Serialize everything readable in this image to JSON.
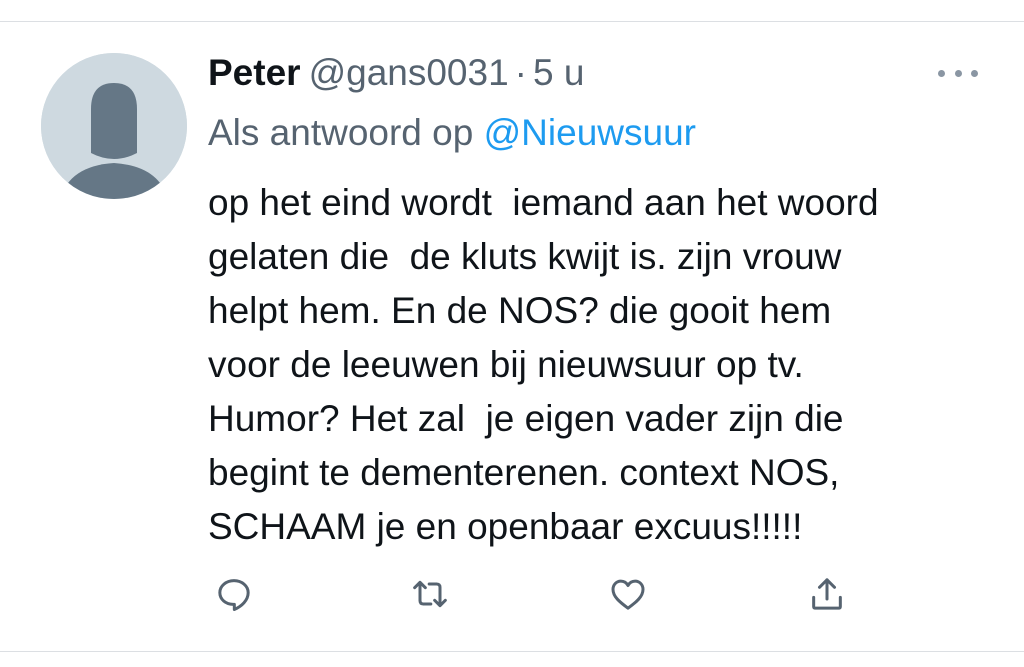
{
  "tweet": {
    "author_name": "Peter",
    "handle": "@gans0031",
    "separator": "·",
    "time": "5 u",
    "reply_prefix": "Als antwoord op",
    "reply_to": "@Nieuwsuur",
    "text_lines": [
      "op het eind wordt  iemand aan het woord",
      "gelaten die  de kluts kwijt is. zijn vrouw",
      "helpt hem. En de NOS? die gooit hem",
      "voor de leeuwen bij nieuwsuur op tv.",
      "Humor? Het zal  je eigen vader zijn die",
      "begint te dementerenen. context NOS,",
      "SCHAAM je en openbaar excuus!!!!!"
    ]
  },
  "icons": {
    "avatar": "default-avatar-icon",
    "more": "more-options-icon",
    "reply": "reply-icon",
    "retweet": "retweet-icon",
    "like": "heart-icon",
    "share": "share-icon"
  },
  "colors": {
    "text": "#0f1419",
    "secondary": "#566370",
    "mention": "#1d9bf0",
    "icon": "#566370",
    "avatar_bg": "#ced9e0",
    "avatar_fg": "#657786",
    "divider": "#dcdfe3"
  }
}
